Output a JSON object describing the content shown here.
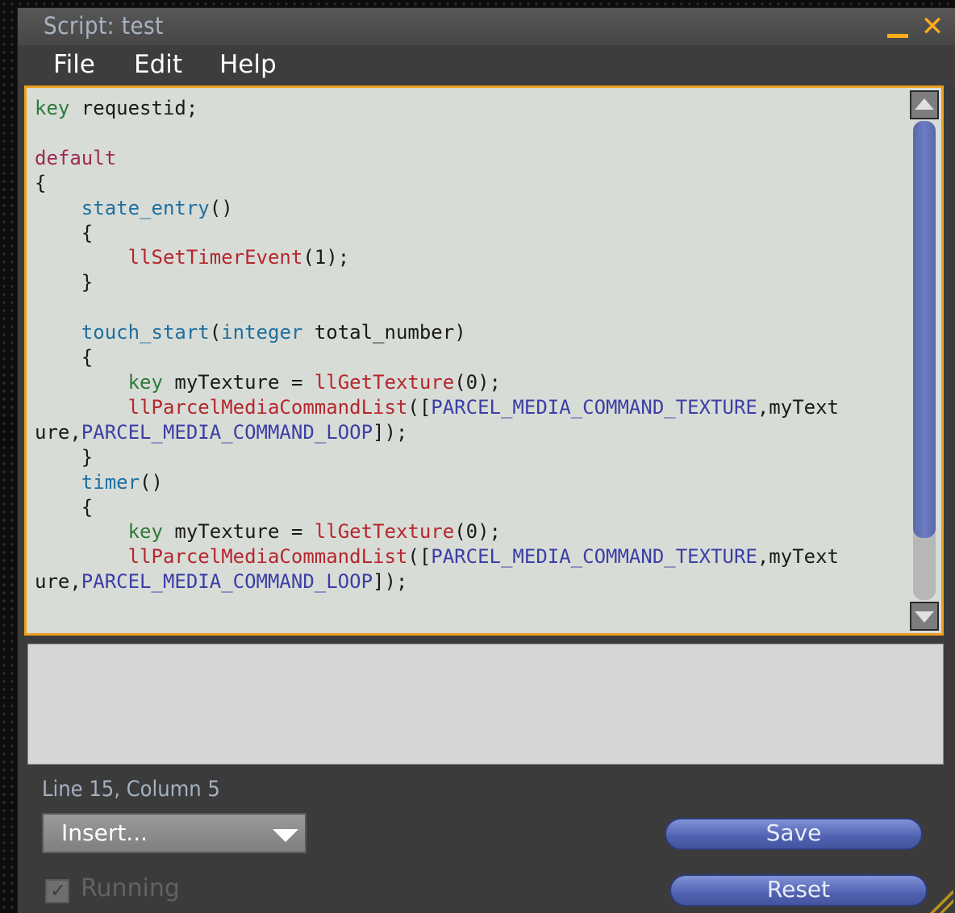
{
  "window": {
    "title": "Script: test",
    "minimize_icon": "minimize-icon",
    "close_icon": "close-icon",
    "close_glyph": "✕"
  },
  "menu": {
    "items": [
      "File",
      "Edit",
      "Help"
    ]
  },
  "editor": {
    "lines": [
      [
        {
          "t": "key",
          "c": "type"
        },
        {
          "t": " requestid;",
          "c": ""
        }
      ],
      [],
      [
        {
          "t": "default",
          "c": "state"
        }
      ],
      [
        {
          "t": "{",
          "c": ""
        }
      ],
      [
        {
          "t": "    ",
          "c": ""
        },
        {
          "t": "state_entry",
          "c": "event"
        },
        {
          "t": "()",
          "c": ""
        }
      ],
      [
        {
          "t": "    {",
          "c": ""
        }
      ],
      [
        {
          "t": "        ",
          "c": ""
        },
        {
          "t": "llSetTimerEvent",
          "c": "fn"
        },
        {
          "t": "(1);",
          "c": ""
        }
      ],
      [
        {
          "t": "    }",
          "c": ""
        }
      ],
      [],
      [
        {
          "t": "    ",
          "c": ""
        },
        {
          "t": "touch_start",
          "c": "event"
        },
        {
          "t": "(",
          "c": ""
        },
        {
          "t": "integer",
          "c": "event"
        },
        {
          "t": " total_number)",
          "c": ""
        }
      ],
      [
        {
          "t": "    {",
          "c": ""
        }
      ],
      [
        {
          "t": "        ",
          "c": ""
        },
        {
          "t": "key",
          "c": "type"
        },
        {
          "t": " myTexture = ",
          "c": ""
        },
        {
          "t": "llGetTexture",
          "c": "fn"
        },
        {
          "t": "(0);",
          "c": ""
        }
      ],
      [
        {
          "t": "        ",
          "c": ""
        },
        {
          "t": "llParcelMediaCommandList",
          "c": "fn"
        },
        {
          "t": "([",
          "c": ""
        },
        {
          "t": "PARCEL_MEDIA_COMMAND_TEXTURE",
          "c": "const"
        },
        {
          "t": ",myText",
          "c": ""
        }
      ],
      [
        {
          "t": "ure,",
          "c": ""
        },
        {
          "t": "PARCEL_MEDIA_COMMAND_LOOP",
          "c": "const"
        },
        {
          "t": "]);",
          "c": ""
        }
      ],
      [
        {
          "t": "    }",
          "c": ""
        }
      ],
      [
        {
          "t": "    ",
          "c": ""
        },
        {
          "t": "timer",
          "c": "event"
        },
        {
          "t": "()",
          "c": ""
        }
      ],
      [
        {
          "t": "    {",
          "c": ""
        }
      ],
      [
        {
          "t": "        ",
          "c": ""
        },
        {
          "t": "key",
          "c": "type"
        },
        {
          "t": " myTexture = ",
          "c": ""
        },
        {
          "t": "llGetTexture",
          "c": "fn"
        },
        {
          "t": "(0);",
          "c": ""
        }
      ],
      [
        {
          "t": "        ",
          "c": ""
        },
        {
          "t": "llParcelMediaCommandList",
          "c": "fn"
        },
        {
          "t": "([",
          "c": ""
        },
        {
          "t": "PARCEL_MEDIA_COMMAND_TEXTURE",
          "c": "const"
        },
        {
          "t": ",myText",
          "c": ""
        }
      ],
      [
        {
          "t": "ure,",
          "c": ""
        },
        {
          "t": "PARCEL_MEDIA_COMMAND_LOOP",
          "c": "const"
        },
        {
          "t": "]);",
          "c": ""
        }
      ]
    ],
    "scroll_position": 0.0,
    "scroll_visible_fraction": 0.87
  },
  "status": {
    "cursor_text": "Line 15, Column 5"
  },
  "controls": {
    "insert_label": "Insert...",
    "save_label": "Save",
    "reset_label": "Reset",
    "running_label": "Running",
    "running_checked": true,
    "check_glyph": "✓"
  },
  "colors": {
    "accent_orange": "#f0a020",
    "button_blue": "#5061b0",
    "keyword_type": "#2e7a3a",
    "keyword_state": "#9c2a55",
    "keyword_event": "#1f6fa0",
    "function": "#b5262e",
    "constant": "#3b3fa6"
  }
}
